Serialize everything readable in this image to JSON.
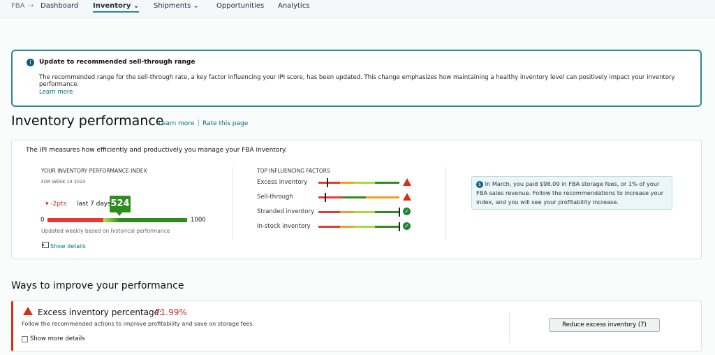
{
  "nav": {
    "root": "FBA",
    "items": [
      "Dashboard",
      "Inventory",
      "Shipments",
      "Opportunities",
      "Analytics"
    ],
    "active": "Inventory"
  },
  "alert": {
    "title": "Update to recommended sell-through range",
    "body": "The recommended range for the sell-through rate, a key factor influencing your IPI score, has been updated. This change emphasizes how maintaining a healthy inventory level can positively impact your inventory performance.",
    "link": "Learn more"
  },
  "page": {
    "title": "Inventory performance",
    "learn_more": "Learn more",
    "rate": "Rate this page"
  },
  "ipi": {
    "intro": "The IPI measures how efficiently and productively you manage your FBA inventory.",
    "heading": "YOUR INVENTORY PERFORMANCE INDEX",
    "week": "FOR WEEK 19 2024",
    "change": "-2pts",
    "period": "last 7 days",
    "score": "524",
    "min": "0",
    "max": "1000",
    "note": "Updated weekly based on historical performance",
    "show_details": "Show details",
    "score_value": 524
  },
  "factors": {
    "heading": "TOP INFLUENCING FACTORS",
    "items": [
      {
        "label": "Excess inventory",
        "status": "warning"
      },
      {
        "label": "Sell-through",
        "status": "warning"
      },
      {
        "label": "Stranded inventory",
        "status": "ok"
      },
      {
        "label": "In-stock inventory",
        "status": "ok"
      }
    ]
  },
  "tip": {
    "text": "In March, you paid $98.09 in FBA storage fees, or 1% of your FBA sales revenue. Follow the recommendations to increase your index, and you will see your profitability increase."
  },
  "improve": {
    "title": "Ways to improve your performance",
    "metric_label": "Excess inventory percentage:",
    "metric_value": "71.99%",
    "desc": "Follow the recommended actions to improve profitability and save on storage fees.",
    "show_more": "Show more details",
    "button": "Reduce excess inventory (7)"
  },
  "colors": {
    "accent": "#007185",
    "alert_border": "#2a8a94",
    "red": "#e53935",
    "green": "#2e8b1e"
  }
}
